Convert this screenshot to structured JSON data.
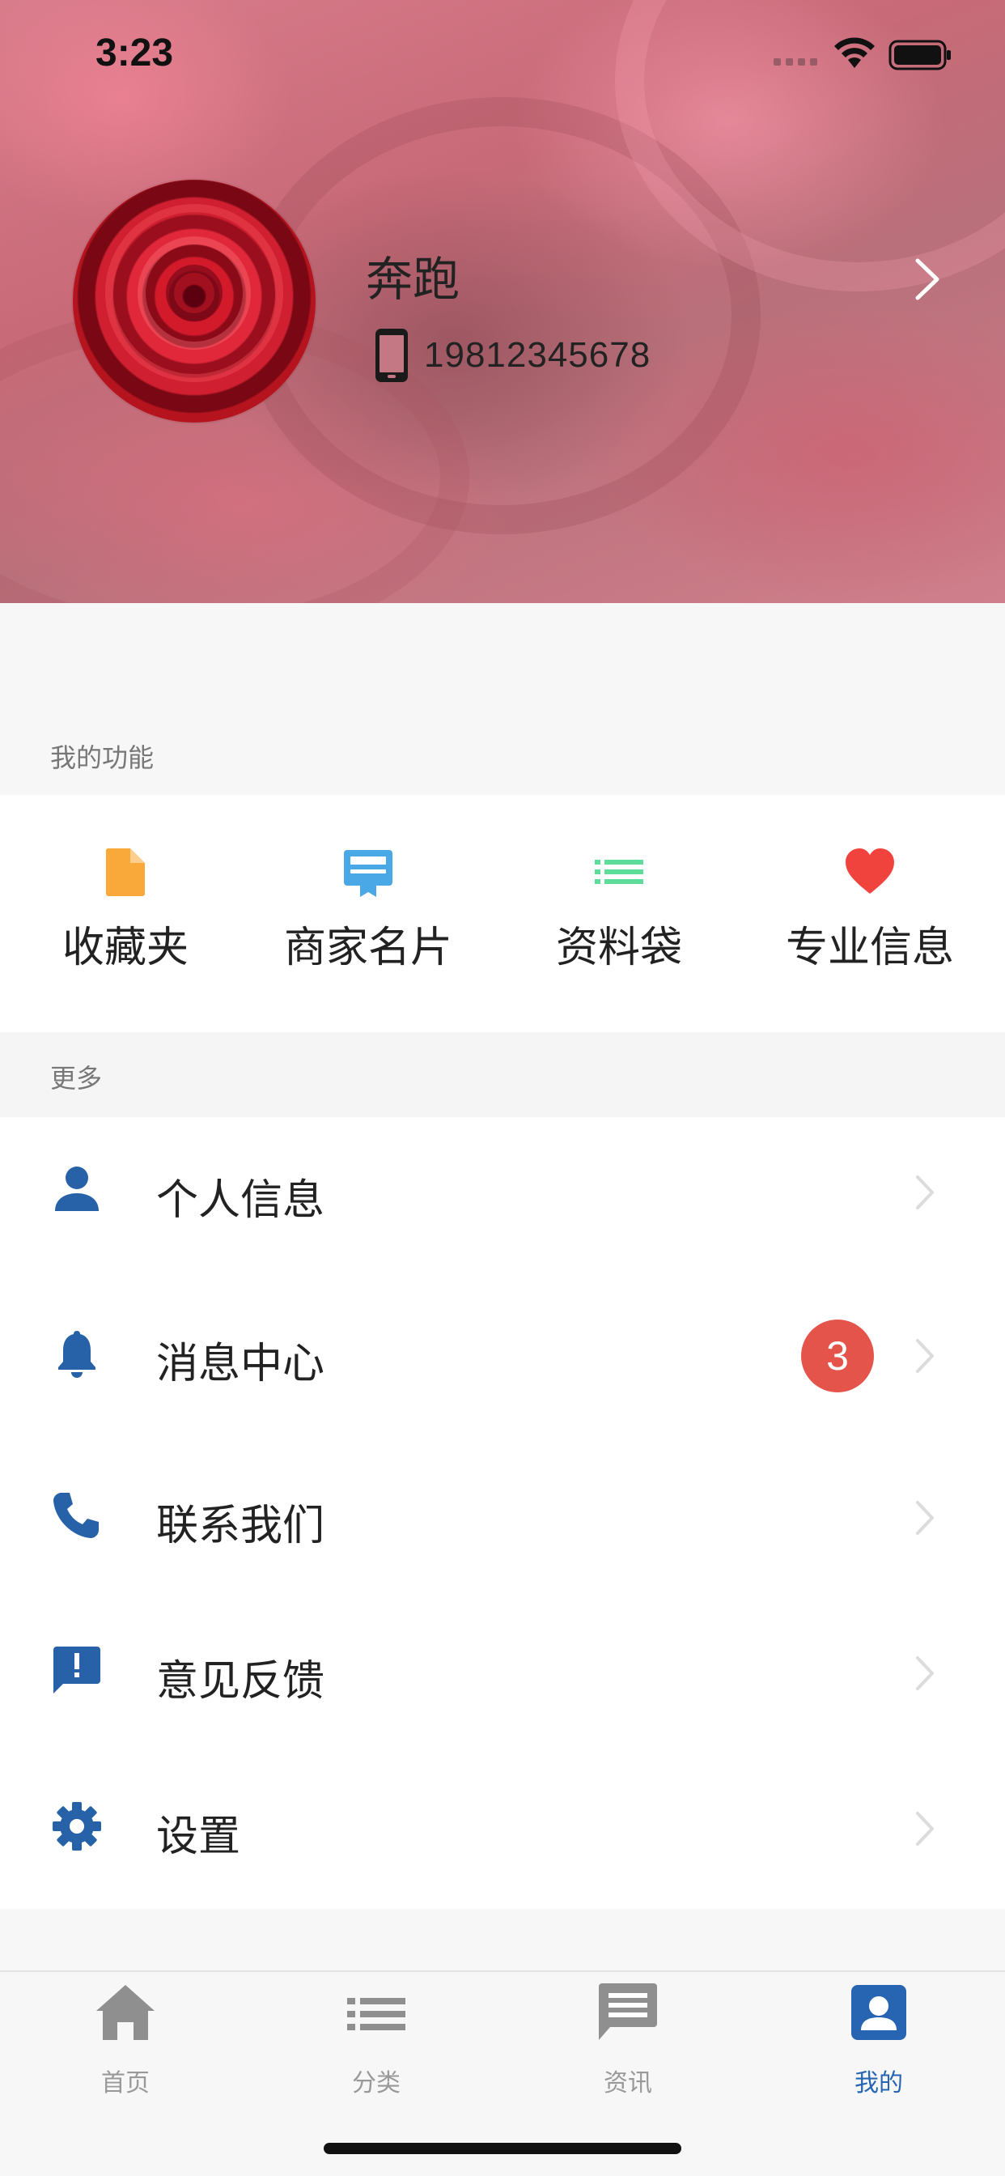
{
  "status_bar": {
    "time": "3:23"
  },
  "profile": {
    "name": "奔跑",
    "phone": "19812345678"
  },
  "functions": {
    "section_label": "我的功能",
    "items": [
      {
        "label": "收藏夹",
        "icon": "file-icon",
        "color": "#f9a93a"
      },
      {
        "label": "商家名片",
        "icon": "card-icon",
        "color": "#4aa8e6"
      },
      {
        "label": "资料袋",
        "icon": "list-icon",
        "color": "#5edc9a"
      },
      {
        "label": "专业信息",
        "icon": "heart-icon",
        "color": "#f0433e"
      }
    ]
  },
  "more": {
    "section_label": "更多",
    "items": [
      {
        "label": "个人信息",
        "icon": "person-icon"
      },
      {
        "label": "消息中心",
        "icon": "bell-icon",
        "badge": "3"
      },
      {
        "label": "联系我们",
        "icon": "phone-icon"
      },
      {
        "label": "意见反馈",
        "icon": "feedback-icon"
      },
      {
        "label": "设置",
        "icon": "gear-icon"
      }
    ]
  },
  "tabbar": {
    "items": [
      {
        "label": "首页",
        "icon": "home-icon",
        "active": false
      },
      {
        "label": "分类",
        "icon": "list-icon",
        "active": false
      },
      {
        "label": "资讯",
        "icon": "message-icon",
        "active": false
      },
      {
        "label": "我的",
        "icon": "profile-icon",
        "active": true
      }
    ]
  },
  "colors": {
    "accent": "#2765b3",
    "icon_blue": "#2762a8",
    "badge": "#e5544b",
    "inactive_tab": "#999999"
  }
}
